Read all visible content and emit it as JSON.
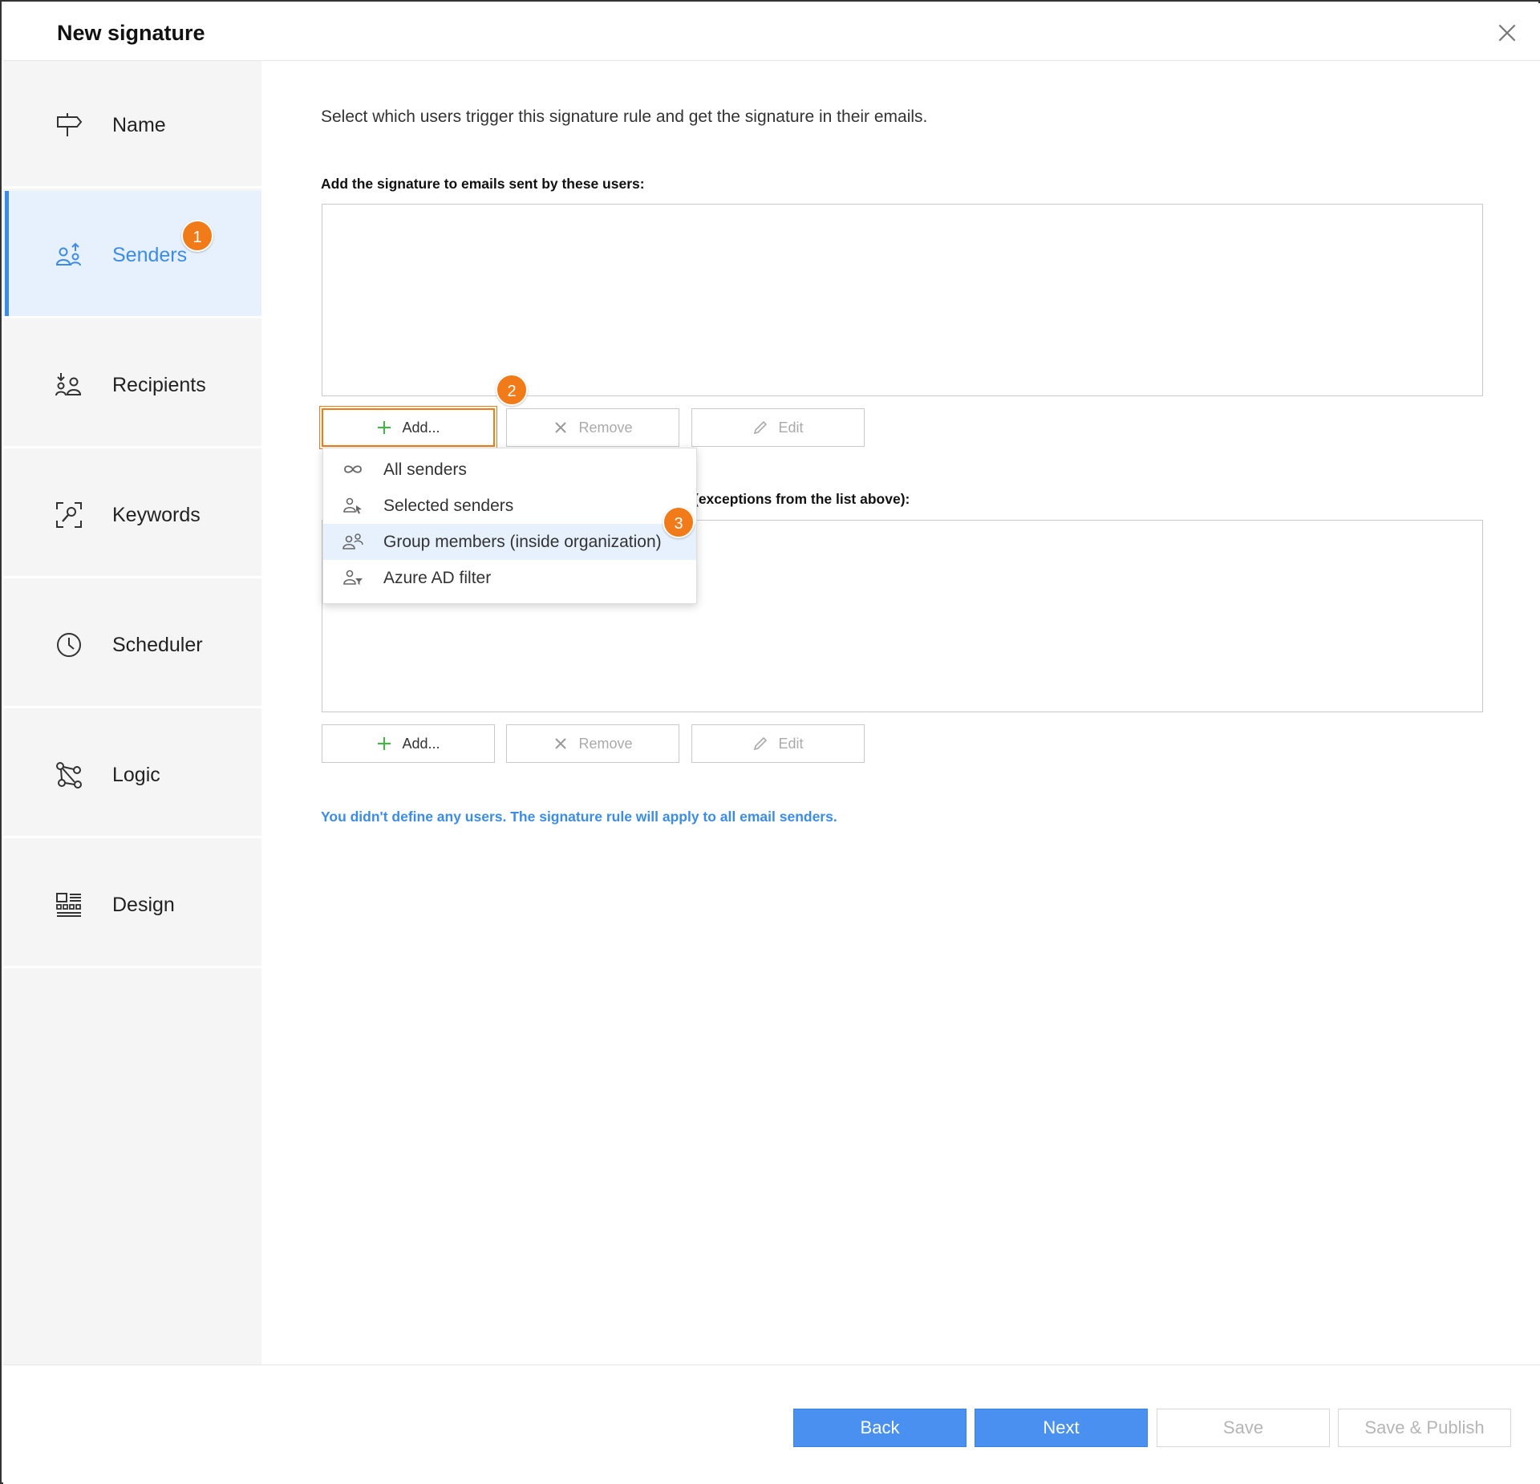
{
  "header": {
    "title": "New signature"
  },
  "sidebar": {
    "items": [
      {
        "label": "Name",
        "icon": "signpost-icon"
      },
      {
        "label": "Senders",
        "icon": "senders-icon",
        "active": true
      },
      {
        "label": "Recipients",
        "icon": "recipients-icon"
      },
      {
        "label": "Keywords",
        "icon": "keywords-icon"
      },
      {
        "label": "Scheduler",
        "icon": "clock-icon"
      },
      {
        "label": "Logic",
        "icon": "logic-icon"
      },
      {
        "label": "Design",
        "icon": "design-icon"
      }
    ]
  },
  "badges": [
    "1",
    "2",
    "3"
  ],
  "main": {
    "description": "Select which users trigger this signature rule and get the signature in their emails.",
    "include_label": "Add the signature to emails sent by these users:",
    "exclude_label_partial": "(exceptions from the list above):",
    "buttons": {
      "add": "Add...",
      "remove": "Remove",
      "edit": "Edit"
    },
    "info": "You didn't define any users. The signature rule will apply to all email senders."
  },
  "dropdown": {
    "items": [
      {
        "label": "All senders",
        "icon": "infinity-icon"
      },
      {
        "label": "Selected senders",
        "icon": "user-cursor-icon"
      },
      {
        "label": "Group members (inside organization)",
        "icon": "group-icon",
        "hover": true
      },
      {
        "label": "Azure AD filter",
        "icon": "user-filter-icon"
      }
    ]
  },
  "footer": {
    "back": "Back",
    "next": "Next",
    "save": "Save",
    "save_publish": "Save & Publish"
  },
  "colors": {
    "accent": "#3c8ce7",
    "primary_button": "#4a90f0",
    "badge": "#f07b18",
    "active_nav_bg": "#e6f1fd",
    "add_icon": "#4caf50"
  }
}
